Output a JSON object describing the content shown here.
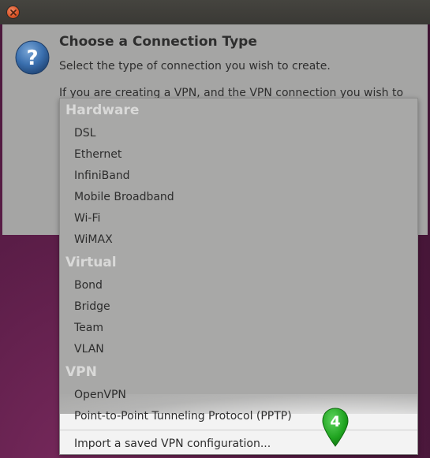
{
  "titlebar": {
    "close_icon": "close-icon"
  },
  "dialog": {
    "icon": "question-icon",
    "title": "Choose a Connection Type",
    "description": "Select the type of connection you wish to create.",
    "note_partial": "If you are creating a VPN, and the VPN connection you wish to"
  },
  "menu": {
    "sections": [
      {
        "label": "Hardware",
        "items": [
          "DSL",
          "Ethernet",
          "InfiniBand",
          "Mobile Broadband",
          "Wi-Fi",
          "WiMAX"
        ]
      },
      {
        "label": "Virtual",
        "items": [
          "Bond",
          "Bridge",
          "Team",
          "VLAN"
        ]
      },
      {
        "label": "VPN",
        "items": [
          "OpenVPN",
          "Point-to-Point Tunneling Protocol (PPTP)"
        ]
      }
    ],
    "import_item": "Import a saved VPN configuration..."
  },
  "annotation": {
    "marker_number": "4",
    "marker_color": "#1fa31f",
    "icon": "map-pin-icon"
  }
}
